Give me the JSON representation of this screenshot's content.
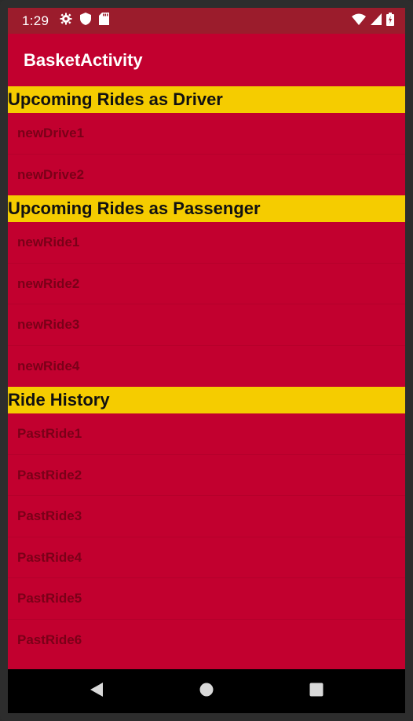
{
  "status_bar": {
    "time": "1:29",
    "icons_left": [
      "gear-icon",
      "shield-icon",
      "sd-card-icon"
    ],
    "icons_right": [
      "wifi-icon",
      "signal-icon",
      "battery-icon"
    ]
  },
  "app_bar": {
    "title": "BasketActivity",
    "color": "#c2002f"
  },
  "sections": [
    {
      "header": "Upcoming Rides as Driver",
      "items": [
        "newDrive1",
        "newDrive2"
      ]
    },
    {
      "header": "Upcoming Rides as Passenger",
      "items": [
        "newRide1",
        "newRide2",
        "newRide3",
        "newRide4"
      ]
    },
    {
      "header": "Ride History",
      "items": [
        "PastRide1",
        "PastRide2",
        "PastRide3",
        "PastRide4",
        "PastRide5",
        "PastRide6"
      ]
    }
  ],
  "colors": {
    "primary": "#c2002f",
    "status_bar": "#9b1c2c",
    "section_header": "#f5cc00",
    "item_text": "#7a0018"
  },
  "nav_bar": {
    "buttons": [
      "back-icon",
      "home-icon",
      "recents-icon"
    ]
  }
}
